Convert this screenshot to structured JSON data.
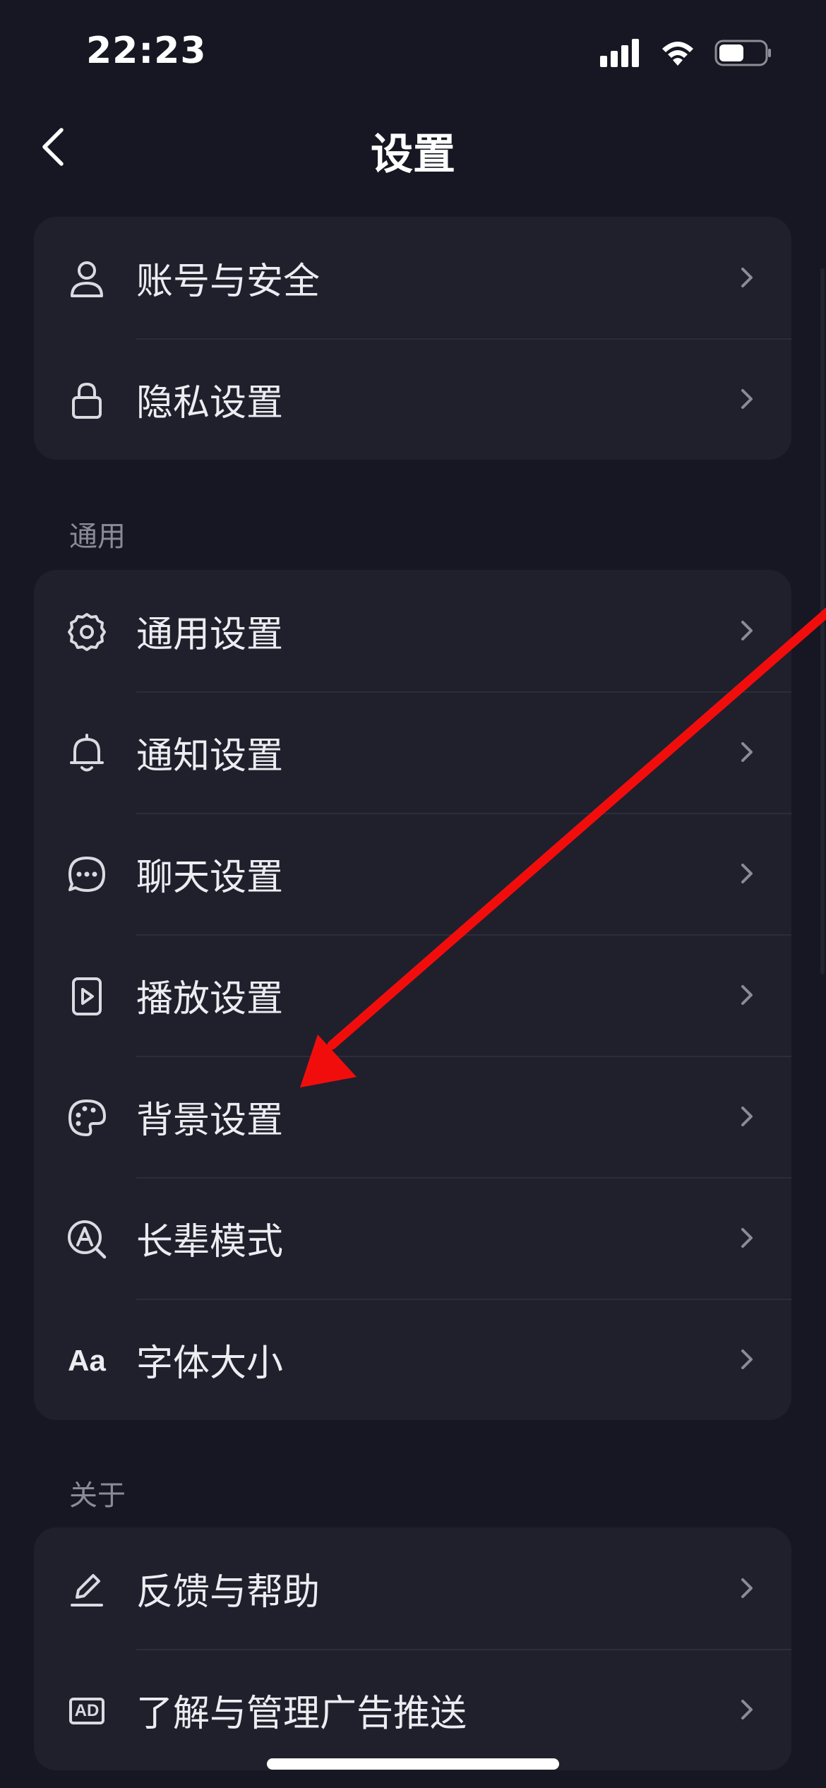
{
  "status_bar": {
    "time": "22:23",
    "icons": [
      "cellular-signal-icon",
      "wifi-icon",
      "battery-icon"
    ],
    "battery_level": 0.55
  },
  "nav": {
    "title": "设置",
    "back_icon": "chevron-left-icon"
  },
  "sections": {
    "general_label": "通用",
    "about_label": "关于"
  },
  "account_card": {
    "items": [
      {
        "label": "账号与安全",
        "icon": "user-icon"
      },
      {
        "label": "隐私设置",
        "icon": "lock-icon"
      }
    ]
  },
  "general_card": {
    "items": [
      {
        "label": "通用设置",
        "icon": "gear-icon"
      },
      {
        "label": "通知设置",
        "icon": "bell-icon"
      },
      {
        "label": "聊天设置",
        "icon": "chat-bubble-icon"
      },
      {
        "label": "播放设置",
        "icon": "play-icon"
      },
      {
        "label": "背景设置",
        "icon": "palette-icon"
      },
      {
        "label": "长辈模式",
        "icon": "elder-mode-icon"
      },
      {
        "label": "字体大小",
        "icon": "font-size-icon",
        "icon_text": "Aa"
      }
    ]
  },
  "about_card": {
    "items": [
      {
        "label": "反馈与帮助",
        "icon": "pencil-icon"
      },
      {
        "label": "了解与管理广告推送",
        "icon": "ad-icon",
        "icon_text": "AD"
      }
    ]
  },
  "colors": {
    "background": "#161722",
    "card": "#1F202C",
    "divider": "#2C2D3A",
    "text": "#ECECF1",
    "section_label": "#8A8B96",
    "annotation_arrow": "#F20D0D"
  }
}
